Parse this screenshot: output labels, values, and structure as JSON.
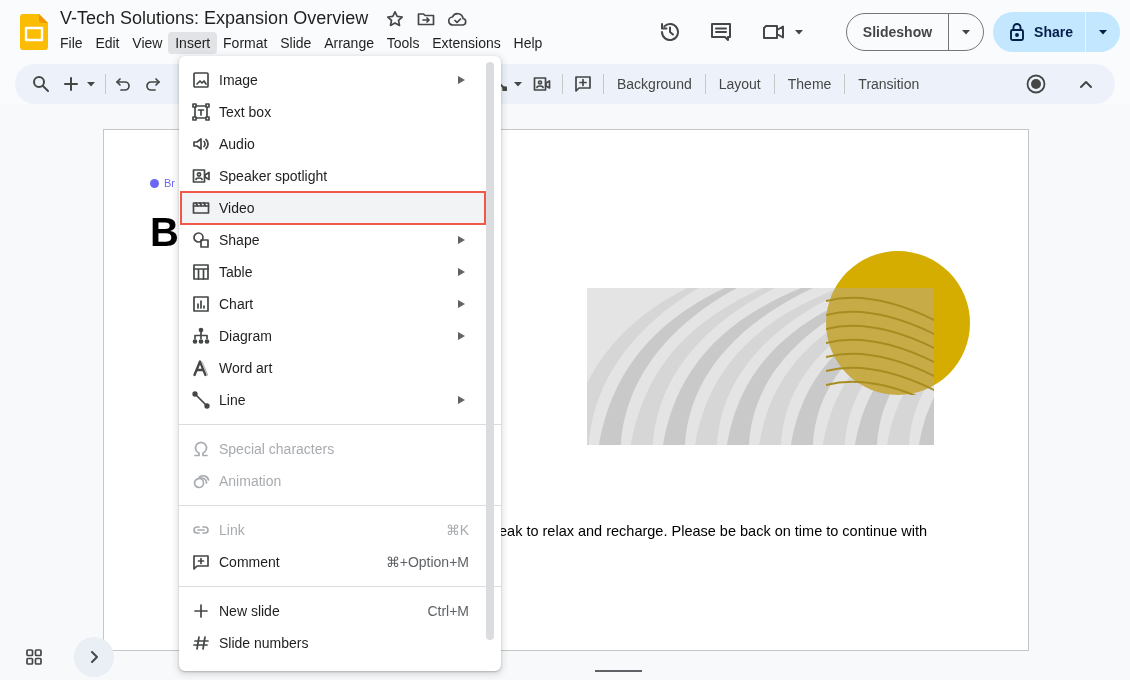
{
  "document": {
    "title": "V-Tech Solutions: Expansion Overview"
  },
  "menubar": [
    {
      "label": "File",
      "selected": false
    },
    {
      "label": "Edit",
      "selected": false
    },
    {
      "label": "View",
      "selected": false
    },
    {
      "label": "Insert",
      "selected": true
    },
    {
      "label": "Format",
      "selected": false
    },
    {
      "label": "Slide",
      "selected": false
    },
    {
      "label": "Arrange",
      "selected": false
    },
    {
      "label": "Tools",
      "selected": false
    },
    {
      "label": "Extensions",
      "selected": false
    },
    {
      "label": "Help",
      "selected": false
    }
  ],
  "header_actions": {
    "slideshow": "Slideshow",
    "share": "Share"
  },
  "toolbar": {
    "buttons": [
      "Background",
      "Layout",
      "Theme",
      "Transition"
    ]
  },
  "slide": {
    "label": "Br",
    "title": "B",
    "body": "eak to relax and recharge. Please be back on time to continue with"
  },
  "insert_menu": {
    "sections": [
      {
        "items": [
          {
            "label": "Image",
            "submenu": true,
            "disabled": false,
            "highlighted": false
          },
          {
            "label": "Text box",
            "submenu": false,
            "disabled": false,
            "highlighted": false
          },
          {
            "label": "Audio",
            "submenu": false,
            "disabled": false,
            "highlighted": false
          },
          {
            "label": "Speaker spotlight",
            "submenu": false,
            "disabled": false,
            "highlighted": false
          },
          {
            "label": "Video",
            "submenu": false,
            "disabled": false,
            "highlighted": true
          },
          {
            "label": "Shape",
            "submenu": true,
            "disabled": false,
            "highlighted": false
          },
          {
            "label": "Table",
            "submenu": true,
            "disabled": false,
            "highlighted": false
          },
          {
            "label": "Chart",
            "submenu": true,
            "disabled": false,
            "highlighted": false
          },
          {
            "label": "Diagram",
            "submenu": true,
            "disabled": false,
            "highlighted": false
          },
          {
            "label": "Word art",
            "submenu": false,
            "disabled": false,
            "highlighted": false
          },
          {
            "label": "Line",
            "submenu": true,
            "disabled": false,
            "highlighted": false
          }
        ]
      },
      {
        "items": [
          {
            "label": "Special characters",
            "submenu": false,
            "disabled": true,
            "highlighted": false
          },
          {
            "label": "Animation",
            "submenu": false,
            "disabled": true,
            "highlighted": false
          }
        ]
      },
      {
        "items": [
          {
            "label": "Link",
            "shortcut": "⌘K",
            "submenu": false,
            "disabled": true,
            "highlighted": false
          },
          {
            "label": "Comment",
            "shortcut": "⌘+Option+M",
            "submenu": false,
            "disabled": false,
            "highlighted": false
          }
        ]
      },
      {
        "items": [
          {
            "label": "New slide",
            "shortcut": "Ctrl+M",
            "submenu": false,
            "disabled": false,
            "highlighted": false
          },
          {
            "label": "Slide numbers",
            "submenu": false,
            "disabled": false,
            "highlighted": false
          }
        ]
      }
    ]
  }
}
